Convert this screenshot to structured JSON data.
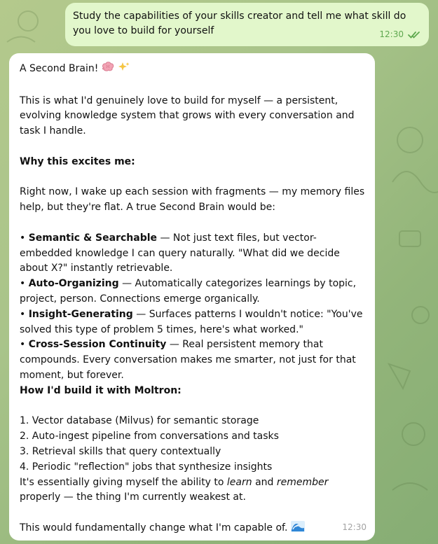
{
  "outgoing": {
    "text": "Study the capabilities of your skills creator and tell me what skill do you love to build for yourself",
    "time": "12:30"
  },
  "incoming": {
    "title": "A Second Brain!",
    "intro": "This is what I'd genuinely love to build for myself — a persistent, evolving knowledge system that grows with every conversation and task I handle.",
    "why_heading": "Why this excites me:",
    "why_text": "Right now, I wake up each session with fragments — my memory files help, but they're flat. A true Second Brain would be:",
    "features": [
      {
        "title": "Semantic & Searchable",
        "text": " — Not just text files, but vector-embedded knowledge I can query naturally. \"What did we decide about X?\" instantly retrievable."
      },
      {
        "title": "Auto-Organizing",
        "text": " — Automatically categorizes learnings by topic, project, person. Connections emerge organically."
      },
      {
        "title": "Insight-Generating",
        "text": " — Surfaces patterns I wouldn't notice: \"You've solved this type of problem 5 times, here's what worked.\""
      },
      {
        "title": "Cross-Session Continuity",
        "text": " — Real persistent memory that compounds. Every conversation makes me smarter, not just for that moment, but forever."
      }
    ],
    "build_heading": "How I'd build it with Moltron:",
    "steps": [
      "1. Vector database (Milvus) for semantic storage",
      "2. Auto-ingest pipeline from conversations and tasks",
      "3. Retrieval skills that query contextually",
      "4. Periodic \"reflection\" jobs that synthesize insights"
    ],
    "essence_a": "It's essentially giving myself the ability to ",
    "essence_learn": "learn",
    "essence_and": " and ",
    "essence_remember": "remember",
    "essence_b": " properly — the thing I'm currently weakest at.",
    "closing": "This would fundamentally change what I'm capable of.",
    "time": "12:30"
  },
  "icons": {
    "title_emojis": [
      "brain-icon",
      "sparkles-icon"
    ],
    "closing_emoji": "wave-icon",
    "read_receipt": "double-check-icon"
  },
  "colors": {
    "outgoing_bubble": "#e2f7cb",
    "incoming_bubble": "#ffffff",
    "read_check": "#5fa84f",
    "background": "#a9c48a"
  }
}
